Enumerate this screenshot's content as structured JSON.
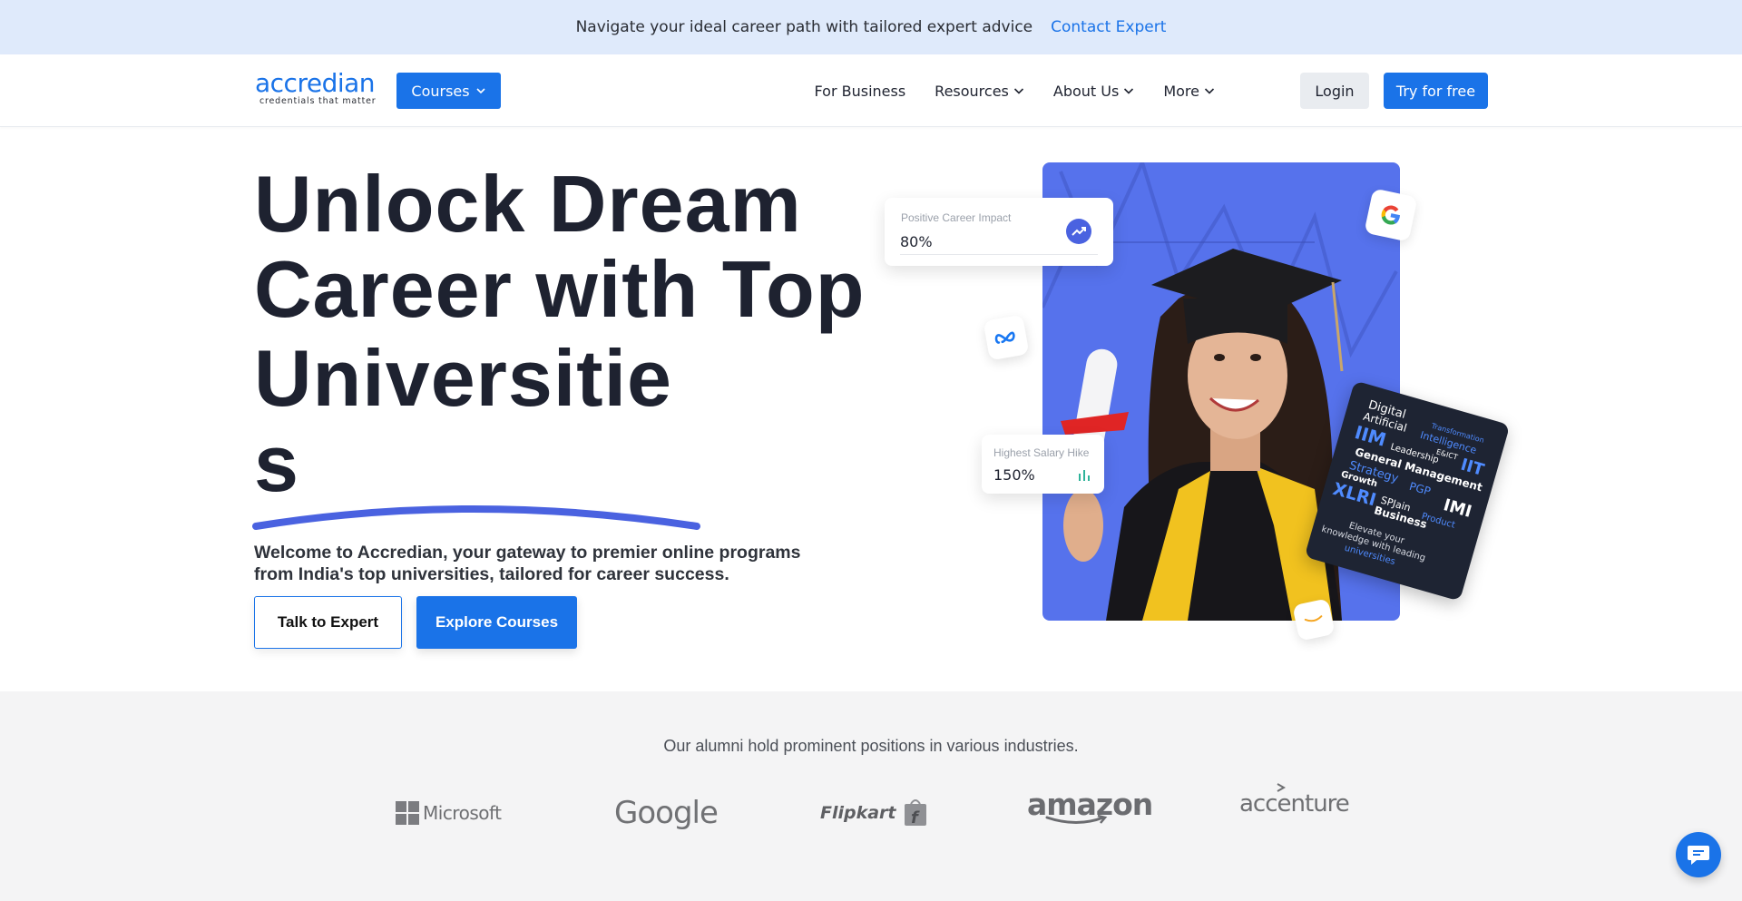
{
  "banner": {
    "message": "Navigate your ideal career path with tailored expert advice",
    "link_label": "Contact Expert"
  },
  "nav": {
    "logo_word": "accredian",
    "logo_tagline": "credentials that matter",
    "courses_label": "Courses",
    "links": [
      {
        "label": "For Business",
        "has_dropdown": false
      },
      {
        "label": "Resources",
        "has_dropdown": true
      },
      {
        "label": "About Us",
        "has_dropdown": true
      },
      {
        "label": "More",
        "has_dropdown": true
      }
    ],
    "login_label": "Login",
    "try_label": "Try for free"
  },
  "hero": {
    "title_lines": [
      "Unlock Dream",
      "Career with Top",
      "Universitie",
      "s"
    ],
    "subtitle": "Welcome to Accredian, your gateway to premier online programs from India's top universities, tailored for career success.",
    "talk_label": "Talk to Expert",
    "explore_label": "Explore Courses",
    "stats": [
      {
        "label": "Positive Career Impact",
        "value": "80%"
      },
      {
        "label": "Highest Salary Hike",
        "value": "150%"
      }
    ],
    "word_cloud": [
      "Digital",
      "Transformation",
      "Artificial",
      "Intelligence",
      "IIM",
      "E&ICT",
      "IIT",
      "Leadership",
      "General Management",
      "Strategy",
      "PGP",
      "Growth",
      "IMI",
      "XLRI",
      "SPJain",
      "Product",
      "Business",
      "Elevate your",
      "knowledge with leading",
      "universities"
    ]
  },
  "alumni": {
    "title": "Our alumni hold prominent positions in various industries.",
    "companies": [
      "Microsoft",
      "Google",
      "Flipkart",
      "amazon",
      "accenture"
    ]
  },
  "colors": {
    "brand_blue": "#1a73e8",
    "banner_bg": "#dfeafb",
    "photo_bg": "#5672ec",
    "accent_curve": "#4a62e0"
  }
}
